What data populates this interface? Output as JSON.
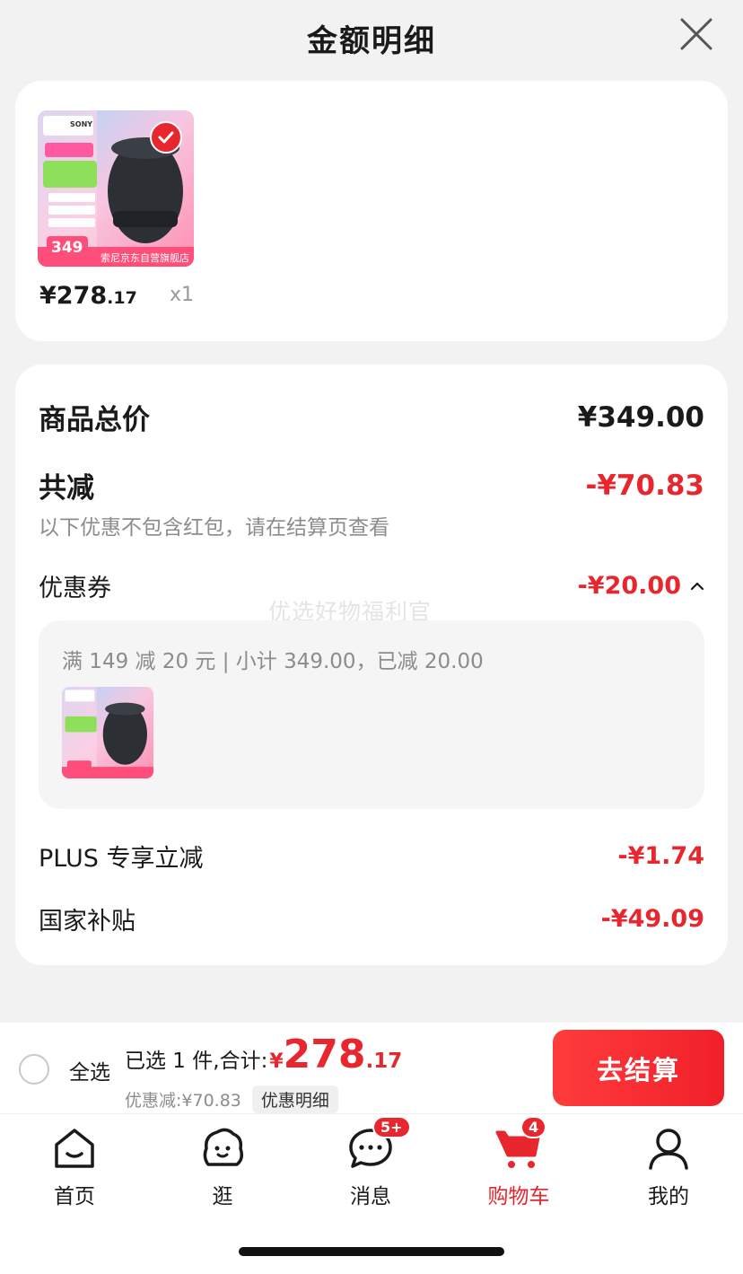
{
  "header": {
    "title": "金额明细"
  },
  "product": {
    "thumb_label": "索尼京东自营旗舰店",
    "thumb_promo_price": "349",
    "thumb_brand": "SONY",
    "price_main": "¥278",
    "price_decimal": ".17",
    "quantity": "x1"
  },
  "detail": {
    "total_label": "商品总价",
    "total_value": "¥349.00",
    "reduce_label": "共减",
    "reduce_value": "-¥70.83",
    "reduce_note": "以下优惠不包含红包，请在结算页查看",
    "coupon_label": "优惠券",
    "coupon_value": "-¥20.00",
    "watermark": "优选好物福利官",
    "coupon_desc": "满 149 减 20 元 | 小计 349.00，已减 20.00",
    "plus_label": "PLUS 专享立减",
    "plus_value": "-¥1.74",
    "subsidy_label": "国家补贴",
    "subsidy_value": "-¥49.09"
  },
  "action_bar": {
    "select_all": "全选",
    "selected_text": "已选 1 件,合计:",
    "currency": "¥",
    "total_main": "278",
    "total_decimal": ".17",
    "discount_text": "优惠减:¥70.83",
    "discount_detail": "优惠明细",
    "checkout": "去结算"
  },
  "tabs": [
    {
      "label": "首页",
      "icon": "home-icon"
    },
    {
      "label": "逛",
      "icon": "explore-icon"
    },
    {
      "label": "消息",
      "icon": "message-icon",
      "badge": "5+"
    },
    {
      "label": "购物车",
      "icon": "cart-icon",
      "badge": "4",
      "active": true
    },
    {
      "label": "我的",
      "icon": "profile-icon"
    }
  ],
  "colors": {
    "accent": "#e8262d",
    "muted": "#8c8c8c"
  }
}
